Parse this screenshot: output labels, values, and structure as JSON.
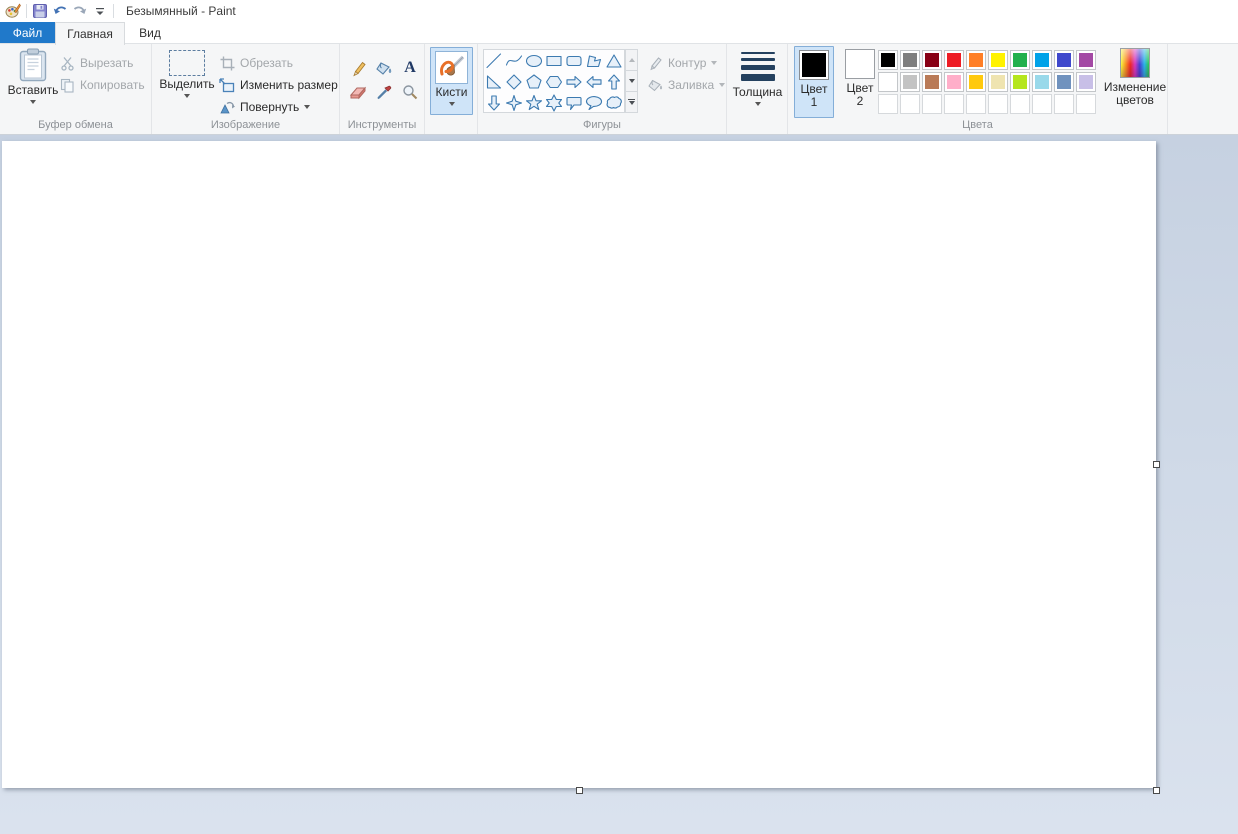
{
  "titlebar": {
    "title": "Безымянный - Paint",
    "quick_access_icons": [
      "paint-logo",
      "save",
      "undo",
      "redo",
      "customize-quick-access"
    ]
  },
  "tabs": [
    {
      "label": "Файл",
      "type": "file-menu",
      "color": "#2079ca"
    },
    {
      "label": "Главная",
      "active": true
    },
    {
      "label": "Вид",
      "active": false
    }
  ],
  "ribbon": {
    "clipboard": {
      "group_label": "Буфер обмена",
      "paste": "Вставить",
      "cut": "Вырезать",
      "copy": "Копировать",
      "cut_enabled": false,
      "copy_enabled": false
    },
    "image": {
      "group_label": "Изображение",
      "select": "Выделить",
      "crop": "Обрезать",
      "resize": "Изменить размер",
      "rotate": "Повернуть",
      "crop_enabled": false
    },
    "tools": {
      "group_label": "Инструменты",
      "items": [
        "pencil",
        "fill-with-color",
        "text",
        "eraser",
        "color-picker",
        "magnifier"
      ]
    },
    "brushes": {
      "label": "Кисти",
      "selected": true
    },
    "shapes": {
      "group_label": "Фигуры",
      "outline": "Контур",
      "fill": "Заливка",
      "outline_enabled": false,
      "fill_enabled": false,
      "items": [
        "line",
        "curve",
        "ellipse",
        "rectangle",
        "rounded-rectangle",
        "polygon",
        "triangle",
        "right-triangle",
        "diamond",
        "pentagon",
        "hexagon",
        "arrow-right",
        "arrow-left",
        "arrow-up",
        "arrow-down",
        "star-4",
        "star-5",
        "star-6",
        "callout-rounded",
        "callout-oval",
        "callout-cloud"
      ]
    },
    "size": {
      "label": "Толщина"
    },
    "colors": {
      "group_label": "Цвета",
      "color1_label": "Цвет 1",
      "color2_label": "Цвет 2",
      "color1_value": "#000000",
      "color2_value": "#FFFFFF",
      "color1_selected": true,
      "edit_colors": "Изменение цветов",
      "palette_row1": [
        "#000000",
        "#7F7F7F",
        "#880015",
        "#ED1C24",
        "#FF7F27",
        "#FFF200",
        "#22B14C",
        "#00A2E8",
        "#3F48CC",
        "#A349A4"
      ],
      "palette_row2": [
        "#FFFFFF",
        "#C3C3C3",
        "#B97A57",
        "#FFAEC9",
        "#FFC90E",
        "#EFE4B0",
        "#B5E61D",
        "#99D9EA",
        "#7092BE",
        "#C8BFE7"
      ],
      "palette_empty_slots": 10
    }
  },
  "canvas": {
    "background": "#FFFFFF"
  }
}
